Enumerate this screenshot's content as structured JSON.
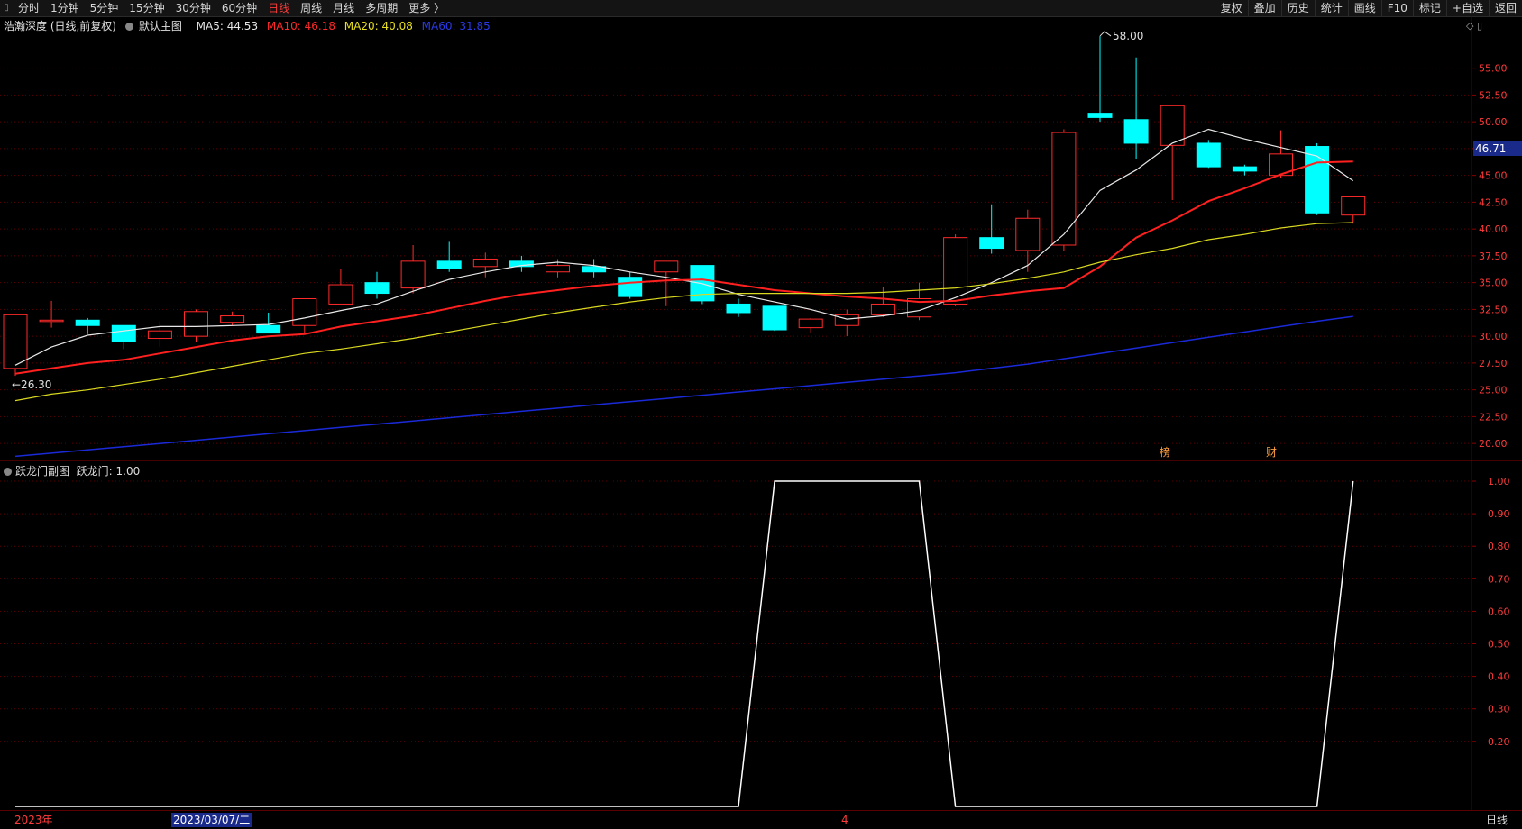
{
  "toolbar": {
    "periods": [
      "分时",
      "1分钟",
      "5分钟",
      "15分钟",
      "30分钟",
      "60分钟",
      "日线",
      "周线",
      "月线",
      "多周期",
      "更多 〉"
    ],
    "active_period": "日线",
    "right_items": [
      "复权",
      "叠加",
      "历史",
      "统计",
      "画线",
      "F10",
      "标记",
      "+自选",
      "返回"
    ]
  },
  "main_legend": {
    "stock": "浩瀚深度 (日线,前复权)",
    "template": "默认主图",
    "ma5": "MA5: 44.53",
    "ma10": "MA10: 46.18",
    "ma20": "MA20: 40.08",
    "ma60": "MA60: 31.85"
  },
  "sub_legend": {
    "title": "跃龙门副图",
    "value": "跃龙门: 1.00"
  },
  "markers": {
    "high": "58.00",
    "low": "26.30",
    "bang": "榜",
    "cai": "财"
  },
  "price_tag": "46.71",
  "bottom": {
    "year": "2023年",
    "cursor_date": "2023/03/07/二",
    "month": "4",
    "period": "日线"
  },
  "colors": {
    "up": "#ff2a2a",
    "down": "#00ffff",
    "ma5": "#e8e8e8",
    "ma10": "#ff2020",
    "ma20": "#d8d820",
    "ma60": "#1a2ad8",
    "grid": "#5a0000",
    "sub_line": "#ffffff"
  },
  "chart_data": [
    {
      "type": "candlestick",
      "title": "浩瀚深度 (日线,前复权)",
      "y_ticks": [
        55.0,
        52.5,
        50.0,
        47.5,
        45.0,
        42.5,
        40.0,
        37.5,
        35.0,
        32.5,
        30.0,
        27.5,
        25.0,
        22.5,
        20.0
      ],
      "ylim": [
        18.5,
        58.5
      ],
      "candles": [
        {
          "o": 27.0,
          "h": 32.0,
          "l": 26.3,
          "c": 32.0
        },
        {
          "o": 31.5,
          "h": 33.3,
          "l": 30.8,
          "c": 31.5
        },
        {
          "o": 31.5,
          "h": 31.7,
          "l": 30.2,
          "c": 31.0
        },
        {
          "o": 31.0,
          "h": 31.0,
          "l": 28.8,
          "c": 29.5
        },
        {
          "o": 29.8,
          "h": 31.4,
          "l": 29.0,
          "c": 30.5
        },
        {
          "o": 30.0,
          "h": 32.5,
          "l": 29.5,
          "c": 32.3
        },
        {
          "o": 31.3,
          "h": 32.3,
          "l": 31.0,
          "c": 31.9
        },
        {
          "o": 31.0,
          "h": 32.2,
          "l": 30.5,
          "c": 30.3
        },
        {
          "o": 31.0,
          "h": 32.5,
          "l": 30.2,
          "c": 33.5
        },
        {
          "o": 33.0,
          "h": 36.3,
          "l": 33.0,
          "c": 34.8
        },
        {
          "o": 35.0,
          "h": 36.0,
          "l": 33.5,
          "c": 34.0
        },
        {
          "o": 34.5,
          "h": 38.5,
          "l": 34.0,
          "c": 37.0
        },
        {
          "o": 37.0,
          "h": 38.8,
          "l": 36.0,
          "c": 36.3
        },
        {
          "o": 36.5,
          "h": 37.8,
          "l": 35.5,
          "c": 37.2
        },
        {
          "o": 37.0,
          "h": 37.5,
          "l": 36.0,
          "c": 36.5
        },
        {
          "o": 36.0,
          "h": 37.2,
          "l": 35.5,
          "c": 36.6
        },
        {
          "o": 36.5,
          "h": 37.2,
          "l": 35.5,
          "c": 36.0
        },
        {
          "o": 35.5,
          "h": 36.0,
          "l": 33.5,
          "c": 33.7
        },
        {
          "o": 36.0,
          "h": 37.0,
          "l": 32.8,
          "c": 37.0
        },
        {
          "o": 36.6,
          "h": 36.6,
          "l": 33.0,
          "c": 33.3
        },
        {
          "o": 33.0,
          "h": 33.5,
          "l": 31.8,
          "c": 32.2
        },
        {
          "o": 32.8,
          "h": 32.8,
          "l": 30.5,
          "c": 30.6
        },
        {
          "o": 30.8,
          "h": 31.7,
          "l": 30.3,
          "c": 31.6
        },
        {
          "o": 31.0,
          "h": 32.5,
          "l": 30.0,
          "c": 32.0
        },
        {
          "o": 32.0,
          "h": 34.6,
          "l": 31.8,
          "c": 33.0
        },
        {
          "o": 31.8,
          "h": 35.0,
          "l": 31.5,
          "c": 33.5
        },
        {
          "o": 33.0,
          "h": 39.5,
          "l": 32.8,
          "c": 39.2
        },
        {
          "o": 39.2,
          "h": 42.3,
          "l": 37.7,
          "c": 38.2
        },
        {
          "o": 38.0,
          "h": 41.8,
          "l": 36.0,
          "c": 41.0
        },
        {
          "o": 38.5,
          "h": 49.3,
          "l": 38.0,
          "c": 49.0
        },
        {
          "o": 50.8,
          "h": 58.0,
          "l": 50.0,
          "c": 50.4
        },
        {
          "o": 50.2,
          "h": 56.0,
          "l": 46.5,
          "c": 48.0
        },
        {
          "o": 47.8,
          "h": 51.5,
          "l": 42.7,
          "c": 51.5
        },
        {
          "o": 48.0,
          "h": 48.3,
          "l": 45.7,
          "c": 45.8
        },
        {
          "o": 45.8,
          "h": 46.0,
          "l": 45.0,
          "c": 45.4
        },
        {
          "o": 45.0,
          "h": 49.2,
          "l": 44.8,
          "c": 47.0
        },
        {
          "o": 47.7,
          "h": 48.0,
          "l": 41.3,
          "c": 41.5
        },
        {
          "o": 41.3,
          "h": 43.0,
          "l": 40.5,
          "c": 43.0
        }
      ],
      "series": [
        {
          "name": "MA5",
          "values": [
            27.3,
            29.0,
            30.1,
            30.5,
            30.9,
            30.9,
            31.0,
            31.1,
            31.7,
            32.4,
            33.0,
            34.2,
            35.3,
            36.0,
            36.6,
            36.9,
            36.6,
            36.0,
            35.5,
            34.9,
            33.9,
            33.2,
            32.5,
            31.6,
            31.9,
            32.4,
            33.6,
            35.0,
            36.6,
            39.5,
            43.6,
            45.5,
            48.0,
            49.3,
            48.4,
            47.6,
            46.8,
            44.5
          ]
        },
        {
          "name": "MA10",
          "values": [
            26.5,
            27.0,
            27.5,
            27.8,
            28.4,
            29.0,
            29.6,
            30.0,
            30.2,
            30.9,
            31.4,
            31.9,
            32.6,
            33.3,
            33.9,
            34.3,
            34.7,
            35.0,
            35.2,
            35.3,
            34.8,
            34.3,
            34.0,
            33.7,
            33.5,
            33.2,
            33.3,
            33.8,
            34.2,
            34.5,
            36.5,
            39.2,
            40.8,
            42.6,
            43.8,
            45.1,
            46.2,
            46.3
          ]
        },
        {
          "name": "MA20",
          "values": [
            24.0,
            24.6,
            25.0,
            25.5,
            26.0,
            26.6,
            27.2,
            27.8,
            28.4,
            28.8,
            29.3,
            29.8,
            30.4,
            31.0,
            31.6,
            32.2,
            32.7,
            33.2,
            33.6,
            33.9,
            34.0,
            34.0,
            34.0,
            34.0,
            34.1,
            34.3,
            34.5,
            34.9,
            35.4,
            36.0,
            36.9,
            37.6,
            38.2,
            39.0,
            39.5,
            40.1,
            40.5,
            40.6
          ]
        },
        {
          "name": "MA60",
          "values": [
            18.8,
            19.1,
            19.4,
            19.7,
            20.0,
            20.3,
            20.6,
            20.9,
            21.2,
            21.5,
            21.8,
            22.1,
            22.4,
            22.7,
            23.0,
            23.3,
            23.6,
            23.9,
            24.2,
            24.5,
            24.8,
            25.1,
            25.4,
            25.7,
            26.0,
            26.3,
            26.6,
            27.0,
            27.4,
            27.9,
            28.4,
            28.9,
            29.4,
            29.9,
            30.4,
            30.9,
            31.4,
            31.85
          ]
        }
      ]
    },
    {
      "type": "line",
      "title": "跃龙门副图",
      "y_ticks": [
        1.0,
        0.9,
        0.8,
        0.7,
        0.6,
        0.5,
        0.4,
        0.3,
        0.2
      ],
      "ylim": [
        0,
        1
      ],
      "series": [
        {
          "name": "跃龙门",
          "values": [
            0,
            0,
            0,
            0,
            0,
            0,
            0,
            0,
            0,
            0,
            0,
            0,
            0,
            0,
            0,
            0,
            0,
            0,
            0,
            0,
            0,
            1,
            1,
            1,
            1,
            1,
            0,
            0,
            0,
            0,
            0,
            0,
            0,
            0,
            0,
            0,
            0,
            1
          ]
        }
      ]
    }
  ]
}
